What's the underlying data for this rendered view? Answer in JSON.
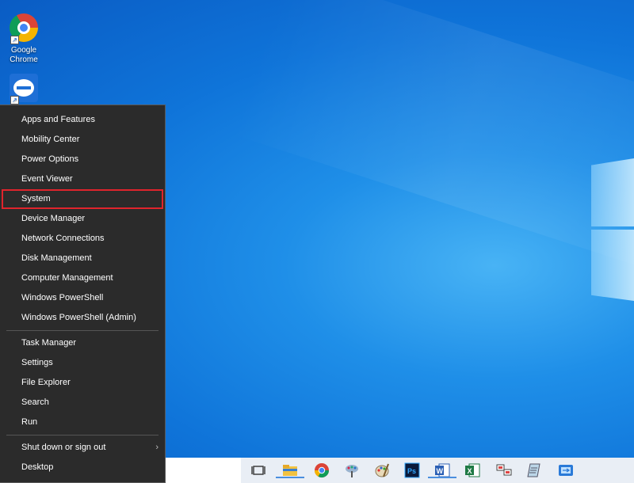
{
  "desktop": {
    "icons": [
      {
        "label": "Google Chrome",
        "icon": "chrome-icon"
      },
      {
        "label": "",
        "icon": "teamviewer-icon"
      }
    ]
  },
  "winx_menu": {
    "items": [
      {
        "label": "Apps and Features"
      },
      {
        "label": "Mobility Center"
      },
      {
        "label": "Power Options"
      },
      {
        "label": "Event Viewer"
      },
      {
        "label": "System",
        "highlighted": true
      },
      {
        "label": "Device Manager"
      },
      {
        "label": "Network Connections"
      },
      {
        "label": "Disk Management"
      },
      {
        "label": "Computer Management"
      },
      {
        "label": "Windows PowerShell"
      },
      {
        "label": "Windows PowerShell (Admin)"
      },
      {
        "label": "Task Manager"
      },
      {
        "label": "Settings"
      },
      {
        "label": "File Explorer"
      },
      {
        "label": "Search"
      },
      {
        "label": "Run"
      },
      {
        "label": "Shut down or sign out",
        "submenu_arrow": "›"
      },
      {
        "label": "Desktop"
      }
    ],
    "highlight_color": "#e0242c"
  },
  "taskbar": {
    "icons": [
      {
        "name": "task-view-icon"
      },
      {
        "name": "file-explorer-icon"
      },
      {
        "name": "chrome-icon"
      },
      {
        "name": "paint-tool-icon"
      },
      {
        "name": "paint-palette-icon"
      },
      {
        "name": "photoshop-icon",
        "text": "Ps",
        "color": "#0b1a3a"
      },
      {
        "name": "word-icon",
        "text": "W",
        "color": "#2b5fb4"
      },
      {
        "name": "excel-icon",
        "text": "X",
        "color": "#1f7a45"
      },
      {
        "name": "remote-desktop-icon"
      },
      {
        "name": "notepad-icon"
      },
      {
        "name": "teamviewer-icon"
      }
    ]
  }
}
